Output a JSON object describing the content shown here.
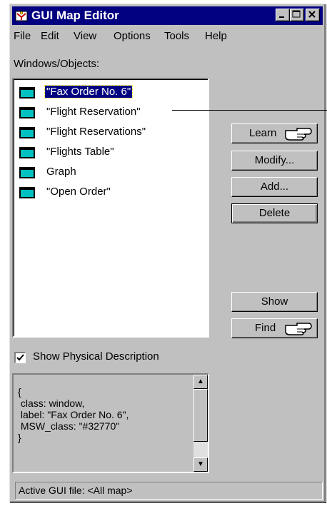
{
  "window": {
    "title": "GUI Map Editor"
  },
  "menu": [
    "File",
    "Edit",
    "View",
    "Options",
    "Tools",
    "Help"
  ],
  "labels": {
    "windows_objects": "Windows/Objects:",
    "show_physical": "Show Physical Description"
  },
  "objects": [
    {
      "label": "\"Fax Order No. 6\"",
      "selected": true
    },
    {
      "label": "\"Flight Reservation\"",
      "selected": false
    },
    {
      "label": "\"Flight Reservations\"",
      "selected": false
    },
    {
      "label": "\"Flights Table\"",
      "selected": false
    },
    {
      "label": "Graph",
      "selected": false
    },
    {
      "label": "\"Open Order\"",
      "selected": false
    }
  ],
  "buttons": {
    "learn": "Learn",
    "modify": "Modify...",
    "add": "Add...",
    "delete": "Delete",
    "show": "Show",
    "find": "Find"
  },
  "physical_description": "{\n class: window,\n label: \"Fax Order No. 6\",\n MSW_class: \"#32770\"\n}",
  "show_physical_checked": true,
  "status": "Active GUI file: <All map>",
  "icons": {
    "title": "app-icon",
    "object": "window-object-icon",
    "hand": "pointing-hand-icon"
  }
}
